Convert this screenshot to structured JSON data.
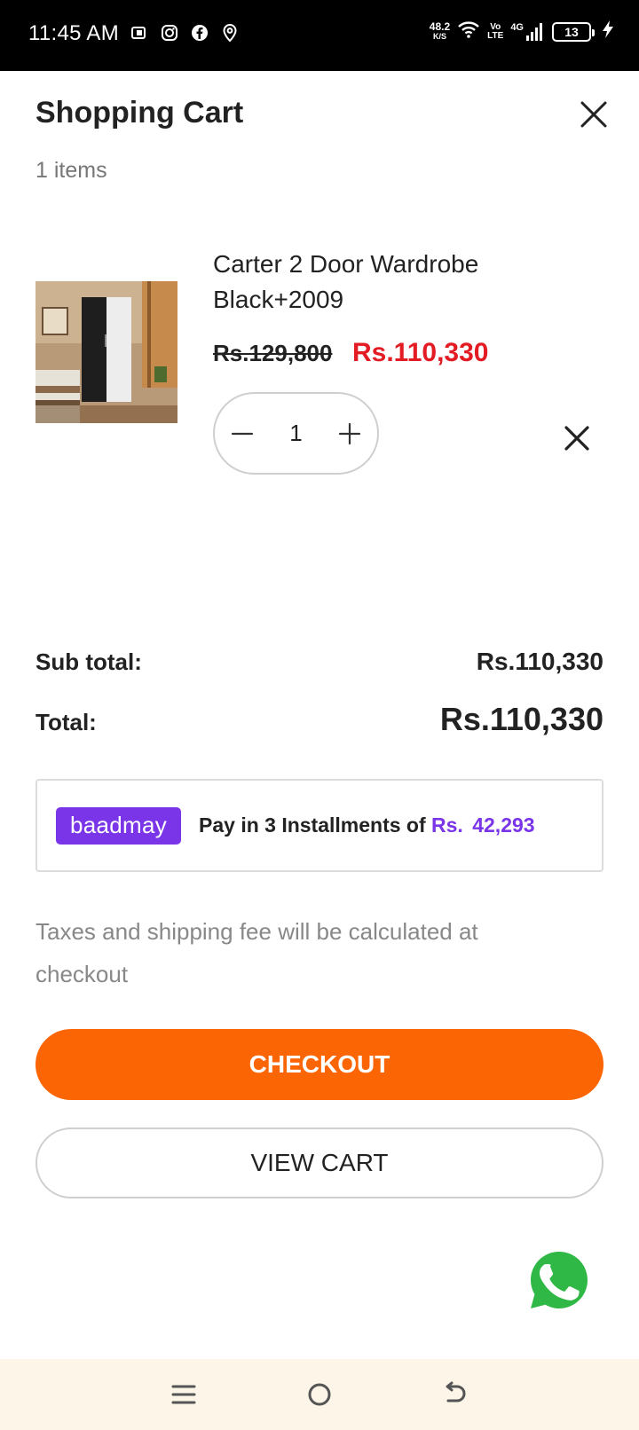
{
  "status_bar": {
    "time": "11:45 AM",
    "net_speed": "48.2",
    "net_unit": "K/S",
    "volte_top": "Vo",
    "volte_bottom": "LTE",
    "network": "4G",
    "battery": "13",
    "icons": [
      "tv-icon",
      "instagram-icon",
      "facebook-icon",
      "location-icon",
      "wifi-icon",
      "signal-icon",
      "battery-icon",
      "charging-icon"
    ]
  },
  "cart": {
    "title": "Shopping Cart",
    "count": "1 items"
  },
  "item": {
    "name": "Carter 2 Door Wardrobe Black+2009",
    "old_price": "Rs.129,800",
    "new_price": "Rs.110,330",
    "quantity": "1"
  },
  "summary": {
    "subtotal_label": "Sub total:",
    "subtotal_value": "Rs.110,330",
    "total_label": "Total:",
    "total_value": "Rs.110,330"
  },
  "installment": {
    "logo": "baadmay",
    "text": "Pay in 3 Installments of",
    "currency": "Rs.",
    "amount": "42,293"
  },
  "tax_note": "Taxes and shipping fee will be calculated at checkout",
  "buttons": {
    "checkout": "CHECKOUT",
    "view_cart": "VIEW CART"
  },
  "colors": {
    "accent_orange": "#fc6504",
    "price_red": "#e31b23",
    "baadmay_purple": "#7a35e8",
    "whatsapp_green": "#2fb845",
    "nav_bg": "#fcf5e8"
  }
}
